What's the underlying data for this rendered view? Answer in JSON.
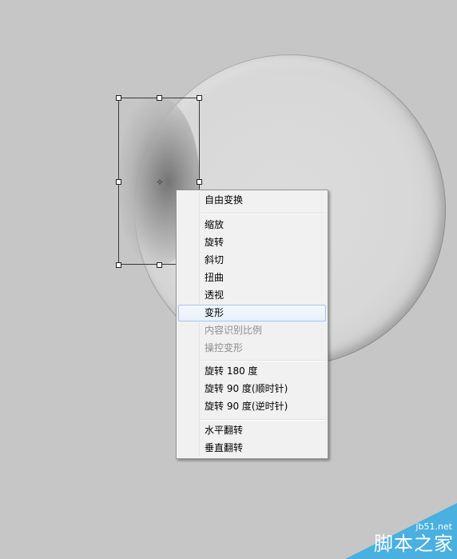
{
  "context_menu": {
    "items": [
      {
        "label": "自由变换",
        "state": "normal"
      },
      {
        "label": "缩放",
        "state": "normal"
      },
      {
        "label": "旋转",
        "state": "normal"
      },
      {
        "label": "斜切",
        "state": "normal"
      },
      {
        "label": "扭曲",
        "state": "normal"
      },
      {
        "label": "透视",
        "state": "normal"
      },
      {
        "label": "变形",
        "state": "hover"
      },
      {
        "label": "内容识别比例",
        "state": "disabled"
      },
      {
        "label": "操控变形",
        "state": "disabled"
      },
      {
        "label": "旋转 180 度",
        "state": "normal"
      },
      {
        "label": "旋转 90 度(顺时针)",
        "state": "normal"
      },
      {
        "label": "旋转 90 度(逆时针)",
        "state": "normal"
      },
      {
        "label": "水平翻转",
        "state": "normal"
      },
      {
        "label": "垂直翻转",
        "state": "normal"
      }
    ]
  },
  "watermark": {
    "site": "jb51.net",
    "name": "脚本之家",
    "color": "#4ab0e0"
  },
  "colors": {
    "canvas_background": "#c6c6c6",
    "menu_background": "#f1f1f1",
    "hover_border": "#a7c6e8"
  }
}
